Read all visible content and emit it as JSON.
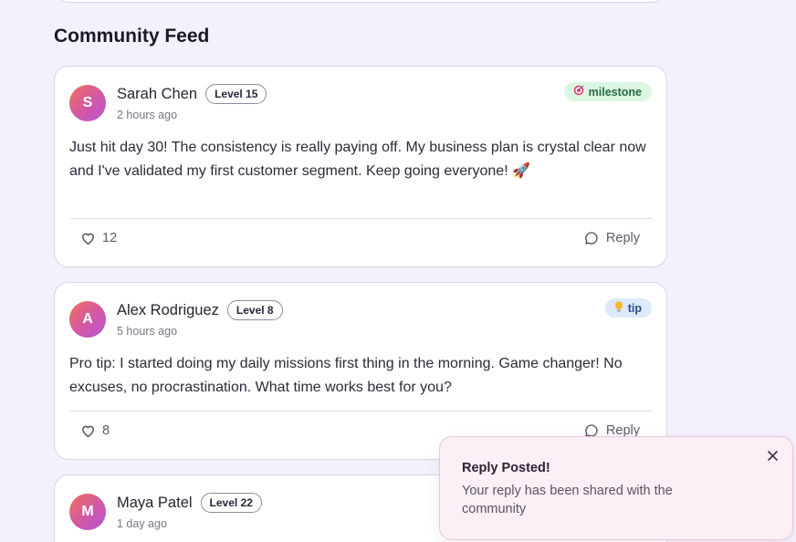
{
  "feed": {
    "title": "Community Feed"
  },
  "posts": [
    {
      "avatar_initial": "S",
      "author": "Sarah Chen",
      "level": "Level 15",
      "time": "2 hours ago",
      "tag": {
        "label": "milestone",
        "icon": "target-icon"
      },
      "body": "Just hit day 30! The consistency is really paying off. My business plan is crystal clear now and I've validated my first customer segment. Keep going everyone! 🚀",
      "likes": "12",
      "reply_label": "Reply"
    },
    {
      "avatar_initial": "A",
      "author": "Alex Rodriguez",
      "level": "Level 8",
      "time": "5 hours ago",
      "tag": {
        "label": "tip",
        "icon": "lightbulb-icon"
      },
      "body": "Pro tip: I started doing my daily missions first thing in the morning. Game changer! No excuses, no procrastination. What time works best for you?",
      "likes": "8",
      "reply_label": "Reply"
    },
    {
      "avatar_initial": "M",
      "author": "Maya Patel",
      "level": "Level 22",
      "time": "1 day ago"
    }
  ],
  "toast": {
    "title": "Reply Posted!",
    "message": "Your reply has been shared with the community"
  },
  "colors": {
    "background": "#f3f1fb",
    "milestone_bg": "#dcf6e3",
    "tip_bg": "#dbe9fb",
    "toast_bg": "#fbf0f5",
    "avatar_gradient_start": "#f2705b",
    "avatar_gradient_end": "#b456d6"
  }
}
